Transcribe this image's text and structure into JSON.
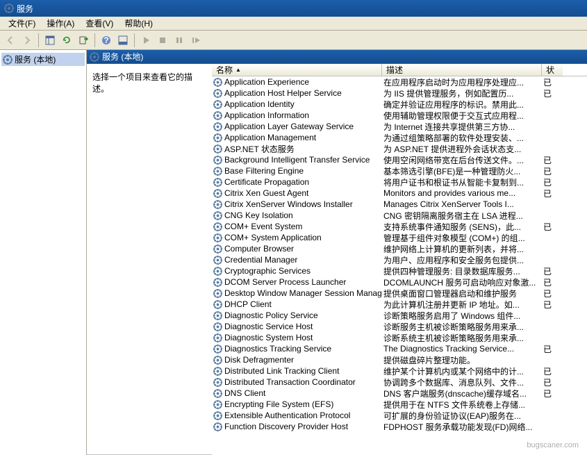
{
  "title": "服务",
  "menu": {
    "file": "文件(F)",
    "action": "操作(A)",
    "view": "查看(V)",
    "help": "帮助(H)"
  },
  "tree": {
    "root": "服务 (本地)"
  },
  "rightHeader": "服务 (本地)",
  "detailPane": {
    "hint": "选择一个项目来查看它的描述。"
  },
  "columns": {
    "name": "名称",
    "desc": "描述",
    "status": "状"
  },
  "services": [
    {
      "name": "Application Experience",
      "desc": "在应用程序启动时为应用程序处理应...",
      "status": "已"
    },
    {
      "name": "Application Host Helper Service",
      "desc": "为 IIS 提供管理服务，例如配置历...",
      "status": "已"
    },
    {
      "name": "Application Identity",
      "desc": "确定并验证应用程序的标识。禁用此...",
      "status": ""
    },
    {
      "name": "Application Information",
      "desc": "使用辅助管理权限便于交互式应用程...",
      "status": ""
    },
    {
      "name": "Application Layer Gateway Service",
      "desc": "为 Internet 连接共享提供第三方协...",
      "status": ""
    },
    {
      "name": "Application Management",
      "desc": "为通过组策略部署的软件处理安装、...",
      "status": ""
    },
    {
      "name": "ASP.NET 状态服务",
      "desc": "为 ASP.NET 提供进程外会话状态支...",
      "status": ""
    },
    {
      "name": "Background Intelligent Transfer Service",
      "desc": "使用空闲网络带宽在后台传送文件。...",
      "status": "已"
    },
    {
      "name": "Base Filtering Engine",
      "desc": "基本筛选引擎(BFE)是一种管理防火...",
      "status": "已"
    },
    {
      "name": "Certificate Propagation",
      "desc": "将用户证书和根证书从智能卡复制到...",
      "status": "已"
    },
    {
      "name": "Citrix Xen Guest Agent",
      "desc": "Monitors and provides various me...",
      "status": "已"
    },
    {
      "name": "Citrix XenServer Windows Installer",
      "desc": "Manages Citrix XenServer Tools I...",
      "status": ""
    },
    {
      "name": "CNG Key Isolation",
      "desc": "CNG 密钥隔离服务宿主在 LSA 进程...",
      "status": ""
    },
    {
      "name": "COM+ Event System",
      "desc": "支持系统事件通知服务 (SENS)，此...",
      "status": "已"
    },
    {
      "name": "COM+ System Application",
      "desc": "管理基于组件对象模型 (COM+) 的组...",
      "status": ""
    },
    {
      "name": "Computer Browser",
      "desc": "维护网络上计算机的更新列表，并将...",
      "status": ""
    },
    {
      "name": "Credential Manager",
      "desc": "为用户、应用程序和安全服务包提供...",
      "status": ""
    },
    {
      "name": "Cryptographic Services",
      "desc": "提供四种管理服务: 目录数据库服务...",
      "status": "已"
    },
    {
      "name": "DCOM Server Process Launcher",
      "desc": "DCOMLAUNCH 服务可启动响应对象激...",
      "status": "已"
    },
    {
      "name": "Desktop Window Manager Session Manager",
      "desc": "提供桌面窗口管理器启动和维护服务",
      "status": "已"
    },
    {
      "name": "DHCP Client",
      "desc": "为此计算机注册并更新 IP 地址。如...",
      "status": "已"
    },
    {
      "name": "Diagnostic Policy Service",
      "desc": "诊断策略服务启用了 Windows 组件...",
      "status": ""
    },
    {
      "name": "Diagnostic Service Host",
      "desc": "诊断服务主机被诊断策略服务用来承...",
      "status": ""
    },
    {
      "name": "Diagnostic System Host",
      "desc": "诊断系统主机被诊断策略服务用来承...",
      "status": ""
    },
    {
      "name": "Diagnostics Tracking Service",
      "desc": "The Diagnostics Tracking Service...",
      "status": "已"
    },
    {
      "name": "Disk Defragmenter",
      "desc": "提供磁盘碎片整理功能。",
      "status": ""
    },
    {
      "name": "Distributed Link Tracking Client",
      "desc": "维护某个计算机内或某个网络中的计...",
      "status": "已"
    },
    {
      "name": "Distributed Transaction Coordinator",
      "desc": "协调跨多个数据库、消息队列、文件...",
      "status": "已"
    },
    {
      "name": "DNS Client",
      "desc": "DNS 客户端服务(dnscache)缓存域名...",
      "status": "已"
    },
    {
      "name": "Encrypting File System (EFS)",
      "desc": "提供用于在 NTFS 文件系统卷上存储...",
      "status": ""
    },
    {
      "name": "Extensible Authentication Protocol",
      "desc": "可扩展的身份验证协议(EAP)服务在...",
      "status": ""
    },
    {
      "name": "Function Discovery Provider Host",
      "desc": "FDPHOST 服务承载功能发现(FD)网络...",
      "status": ""
    }
  ],
  "watermark": "bugscaner.com"
}
